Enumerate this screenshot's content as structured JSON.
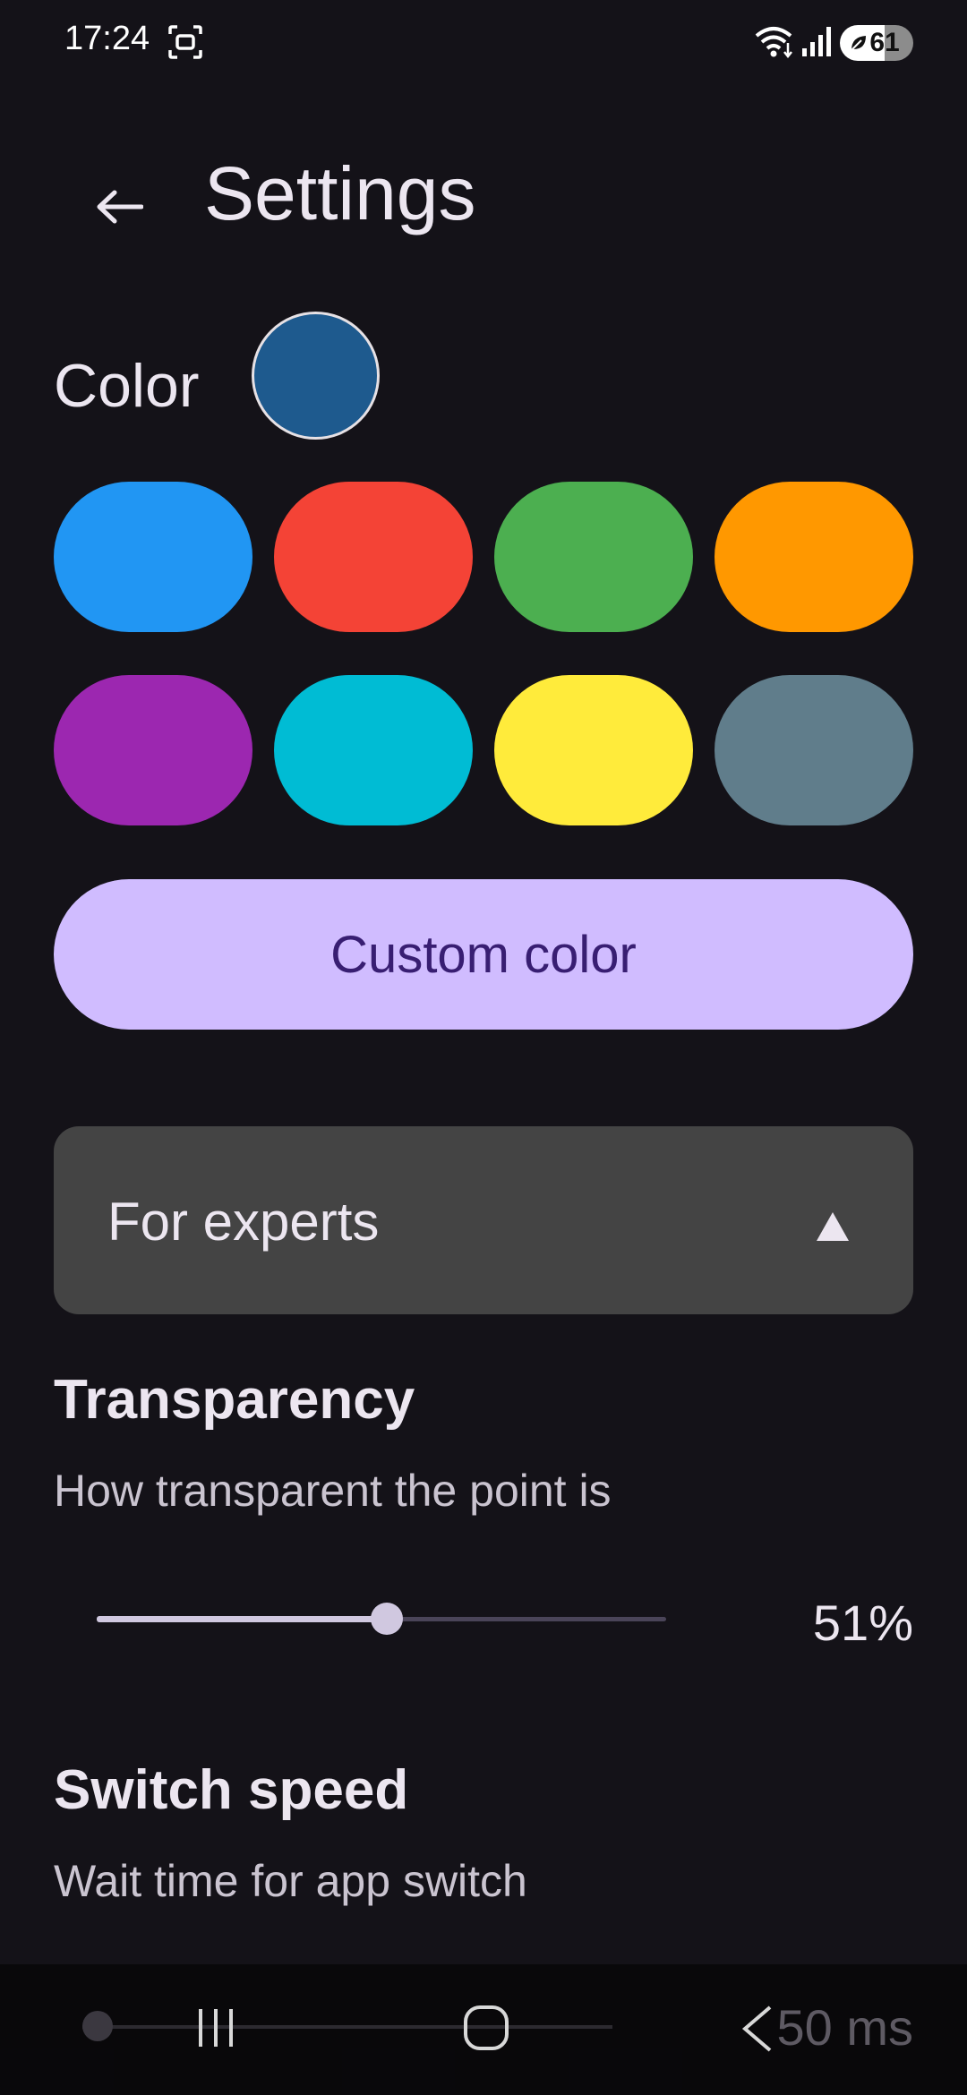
{
  "status_bar": {
    "time": "17:24",
    "battery_level": "61",
    "icons": [
      "screenshot-icon",
      "wifi-icon",
      "signal-icon",
      "battery-saver-leaf-icon"
    ]
  },
  "header": {
    "back_icon": "arrow-left-icon",
    "title": "Settings"
  },
  "color": {
    "label": "Color",
    "selected": "#1e5a8e",
    "swatches": [
      "#2196f3",
      "#f44336",
      "#4caf50",
      "#ff9800",
      "#9c27b0",
      "#00bcd4",
      "#ffeb3b",
      "#607d8b"
    ],
    "custom_button_label": "Custom color"
  },
  "experts": {
    "label": "For experts",
    "expanded": true,
    "icon": "triangle-up-icon"
  },
  "transparency": {
    "title": "Transparency",
    "description": "How transparent the point is",
    "value": 0.51,
    "value_label": "51%"
  },
  "switch_speed": {
    "title": "Switch speed",
    "description": "Wait time for app switch",
    "value_label": "50 ms",
    "value": 0
  },
  "nav_bar": {
    "icons": [
      "recents-icon",
      "home-icon",
      "back-icon"
    ]
  },
  "colors": {
    "background": "#141218",
    "accent": "#d0bcff",
    "accent_text": "#381e72",
    "panel": "#444444"
  }
}
